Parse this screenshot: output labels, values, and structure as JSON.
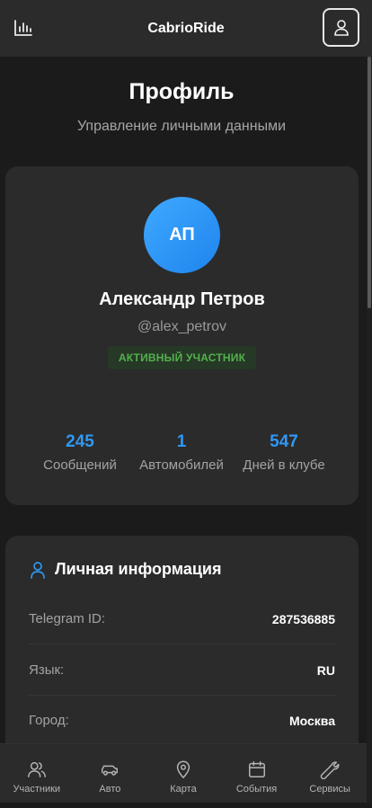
{
  "header": {
    "title": "CabrioRide",
    "left_icon": "bar-chart-icon",
    "right_icon": "user-icon"
  },
  "page": {
    "title": "Профиль",
    "subtitle": "Управление личными данными"
  },
  "profile": {
    "initials": "АП",
    "name": "Александр Петров",
    "handle": "@alex_petrov",
    "status": "АКТИВНЫЙ УЧАСТНИК",
    "stats": [
      {
        "value": "245",
        "label": "Сообщений"
      },
      {
        "value": "1",
        "label": "Автомобилей"
      },
      {
        "value": "547",
        "label": "Дней в клубе"
      }
    ]
  },
  "info": {
    "title": "Личная информация",
    "icon": "user-icon",
    "rows": [
      {
        "label": "Telegram ID:",
        "value": "287536885"
      },
      {
        "label": "Язык:",
        "value": "RU"
      },
      {
        "label": "Город:",
        "value": "Москва"
      }
    ]
  },
  "nav": {
    "items": [
      {
        "label": "Участники",
        "icon": "users-icon"
      },
      {
        "label": "Авто",
        "icon": "car-icon"
      },
      {
        "label": "Карта",
        "icon": "map-pin-icon"
      },
      {
        "label": "События",
        "icon": "calendar-icon"
      },
      {
        "label": "Сервисы",
        "icon": "wrench-icon"
      }
    ]
  },
  "colors": {
    "accent": "#2f98f5",
    "status_green": "#54b04e",
    "background": "#1b1b1b",
    "card": "#2b2b2b"
  }
}
